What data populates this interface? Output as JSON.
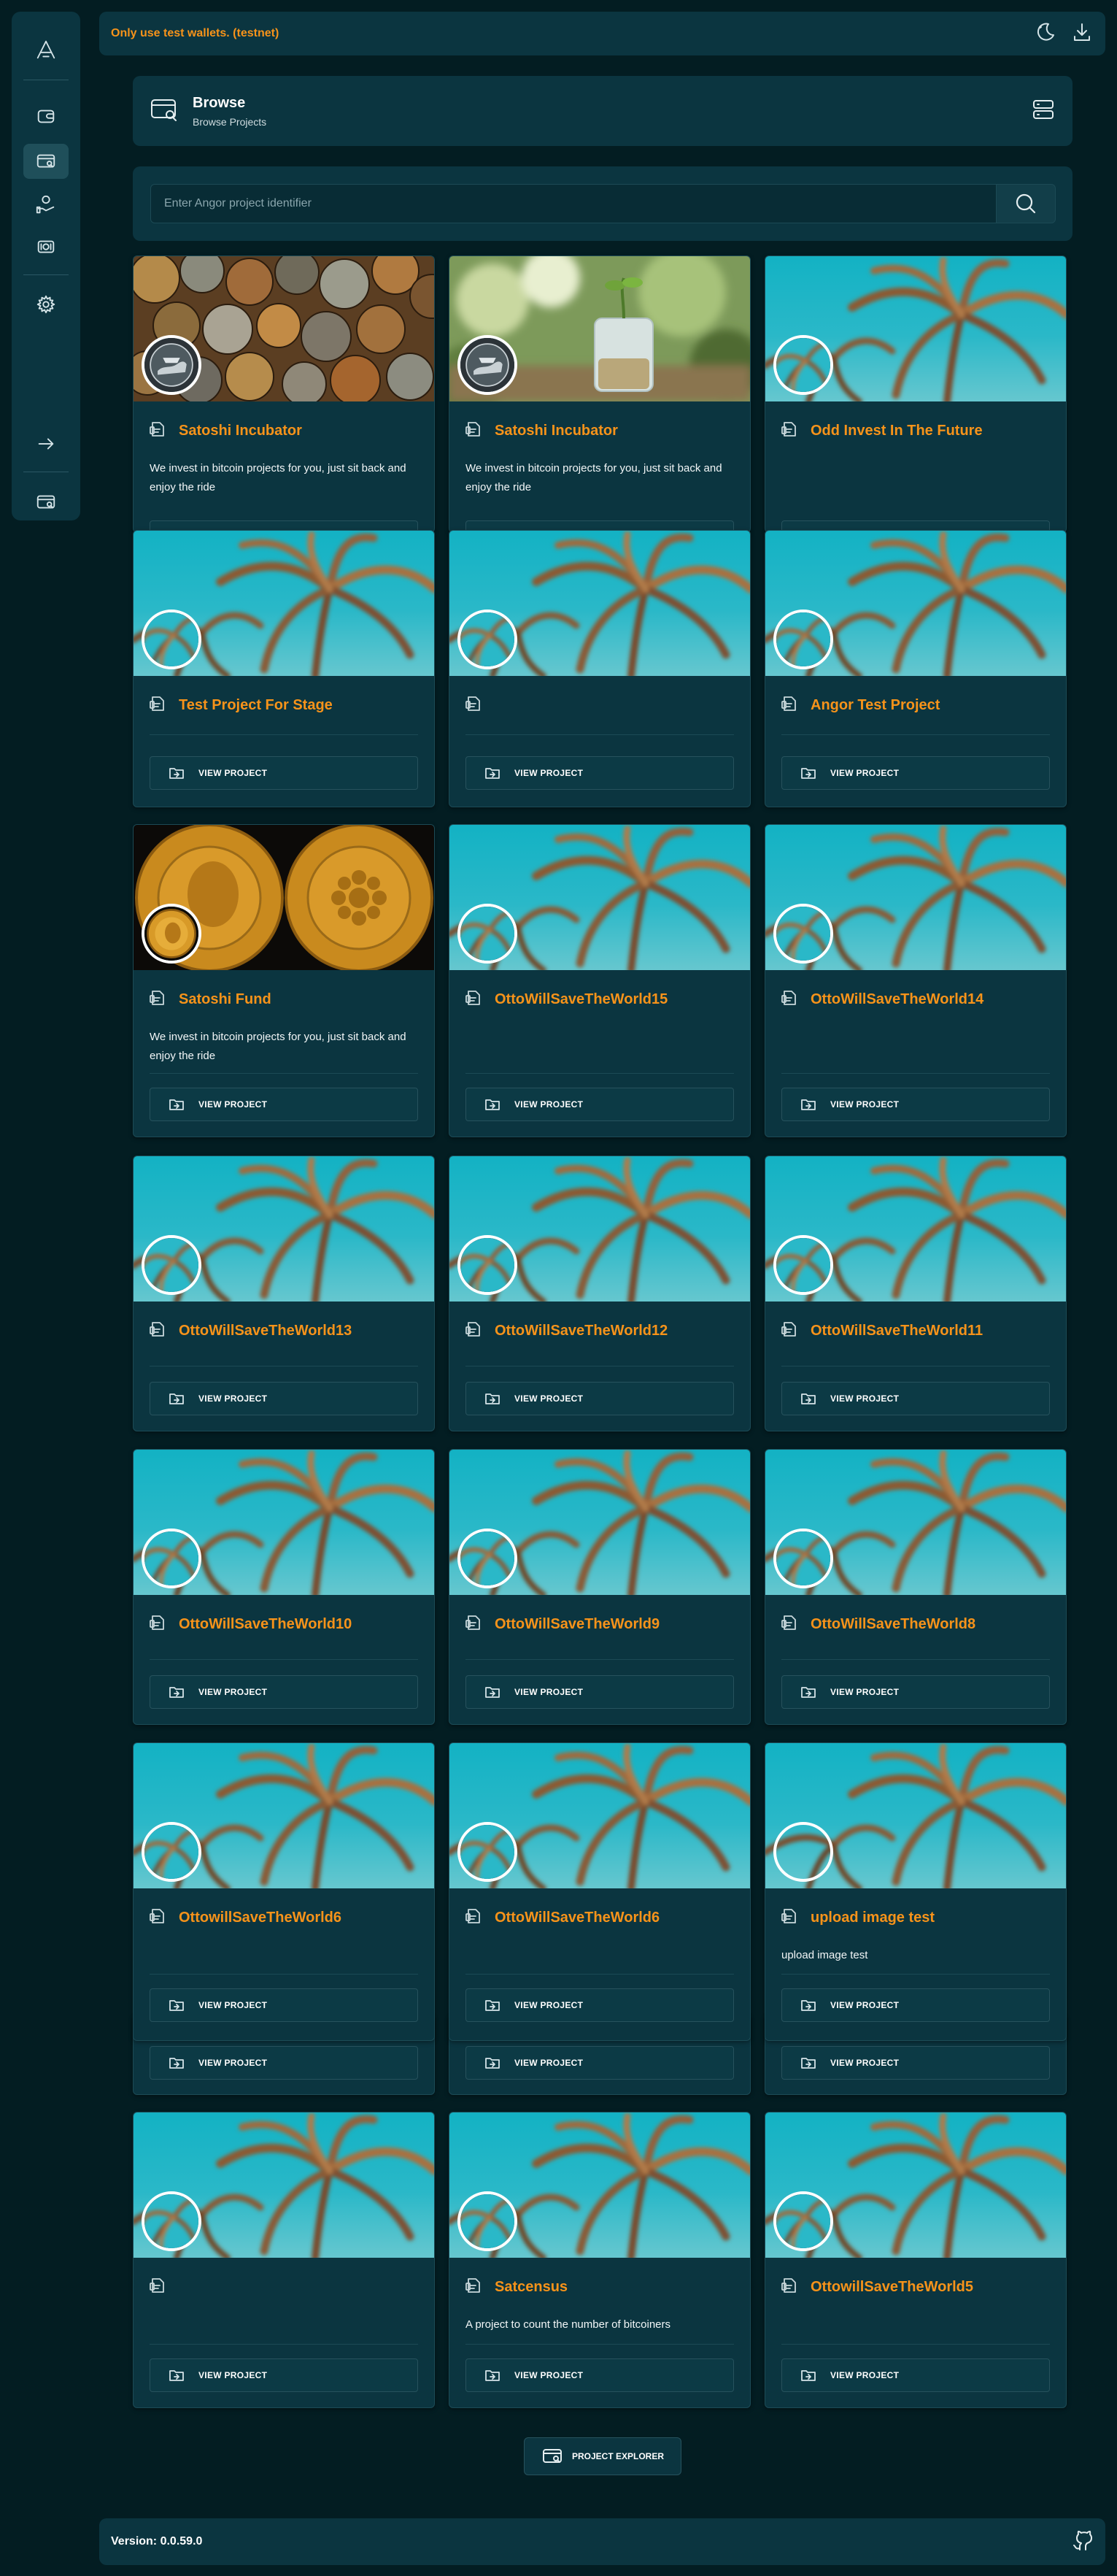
{
  "topbar": {
    "warning": "Only use test wallets. (testnet)",
    "icons": [
      "theme-toggle-icon",
      "install-icon"
    ]
  },
  "sidebar": {
    "items": [
      {
        "name": "logo",
        "icon": "angor-logo-icon"
      },
      {
        "name": "wallet",
        "icon": "wallet-icon"
      },
      {
        "name": "browse",
        "icon": "browse-icon",
        "active": true
      },
      {
        "name": "portfolio",
        "icon": "portfolio-icon"
      },
      {
        "name": "founder",
        "icon": "founder-icon"
      },
      {
        "name": "settings",
        "icon": "gear-icon"
      },
      {
        "name": "sign-out",
        "icon": "arrow-right-icon"
      },
      {
        "name": "explorer",
        "icon": "explorer-icon"
      }
    ]
  },
  "header": {
    "title": "Browse",
    "subtitle": "Browse Projects"
  },
  "search": {
    "placeholder": "Enter Angor project identifier"
  },
  "projects": [
    {
      "title": "Satoshi Incubator",
      "description": "We invest in bitcoin projects for you, just sit back and enjoy the ride",
      "button": "VIEW PROJECT",
      "banner": "coins",
      "avatar": "coin"
    },
    {
      "title": "Satoshi Incubator",
      "description": "We invest in bitcoin projects for you, just sit back and enjoy the ride",
      "button": "VIEW PROJECT",
      "banner": "jar",
      "avatar": "coin"
    },
    {
      "title": "Odd Invest In The Future",
      "description": "",
      "button": "VIEW PROJECT",
      "banner": "palm",
      "avatar": "palm"
    },
    {
      "title": "Test Project For Stage",
      "description": "",
      "button": "VIEW PROJECT",
      "banner": "palm",
      "avatar": "palm"
    },
    {
      "title": "",
      "description": "",
      "button": "VIEW PROJECT",
      "banner": "palm",
      "avatar": "palm"
    },
    {
      "title": "Angor Test Project",
      "description": "",
      "button": "VIEW PROJECT",
      "banner": "palm",
      "avatar": "palm"
    },
    {
      "title": "Satoshi Fund",
      "description": "We invest in bitcoin projects for you, just sit back and enjoy the ride",
      "button": "VIEW PROJECT",
      "banner": "gold",
      "avatar": "gold"
    },
    {
      "title": "OttoWillSaveTheWorld15",
      "description": "",
      "button": "VIEW PROJECT",
      "banner": "palm",
      "avatar": "palm"
    },
    {
      "title": "OttoWillSaveTheWorld14",
      "description": "",
      "button": "VIEW PROJECT",
      "banner": "palm",
      "avatar": "palm"
    },
    {
      "title": "OttoWillSaveTheWorld13",
      "description": "",
      "button": "VIEW PROJECT",
      "banner": "palm",
      "avatar": "palm"
    },
    {
      "title": "OttoWillSaveTheWorld12",
      "description": "",
      "button": "VIEW PROJECT",
      "banner": "palm",
      "avatar": "palm"
    },
    {
      "title": "OttoWillSaveTheWorld11",
      "description": "",
      "button": "VIEW PROJECT",
      "banner": "palm",
      "avatar": "palm"
    },
    {
      "title": "OttoWillSaveTheWorld10",
      "description": "",
      "button": "VIEW PROJECT",
      "banner": "palm",
      "avatar": "palm"
    },
    {
      "title": "OttoWillSaveTheWorld9",
      "description": "",
      "button": "VIEW PROJECT",
      "banner": "palm",
      "avatar": "palm"
    },
    {
      "title": "OttoWillSaveTheWorld8",
      "description": "",
      "button": "VIEW PROJECT",
      "banner": "palm",
      "avatar": "palm"
    },
    {
      "title": "OttowillSaveTheWorld6",
      "description": "",
      "button": "VIEW PROJECT",
      "banner": "palm",
      "avatar": "palm"
    },
    {
      "title": "OttoWillSaveTheWorld6",
      "description": "",
      "button": "VIEW PROJECT",
      "banner": "palm",
      "avatar": "palm"
    },
    {
      "title": "upload image test",
      "description": "upload image test",
      "button": "VIEW PROJECT",
      "banner": "palm",
      "avatar": "empty"
    },
    {
      "title": "",
      "description": "",
      "button": "VIEW PROJECT",
      "banner": "palm",
      "avatar": "palm"
    },
    {
      "title": "Satcensus",
      "description": "A project to count the number of bitcoiners",
      "button": "VIEW PROJECT",
      "banner": "palm",
      "avatar": "palm"
    },
    {
      "title": "OttowillSaveTheWorld5",
      "description": "",
      "button": "VIEW PROJECT",
      "banner": "palm",
      "avatar": "palm"
    }
  ],
  "stacked_buttons": [
    "VIEW PROJECT",
    "VIEW PROJECT",
    "VIEW PROJECT"
  ],
  "explorer": {
    "label": "PROJECT EXPLORER"
  },
  "footer": {
    "version": "Version: 0.0.59.0",
    "icon": "github-icon"
  }
}
